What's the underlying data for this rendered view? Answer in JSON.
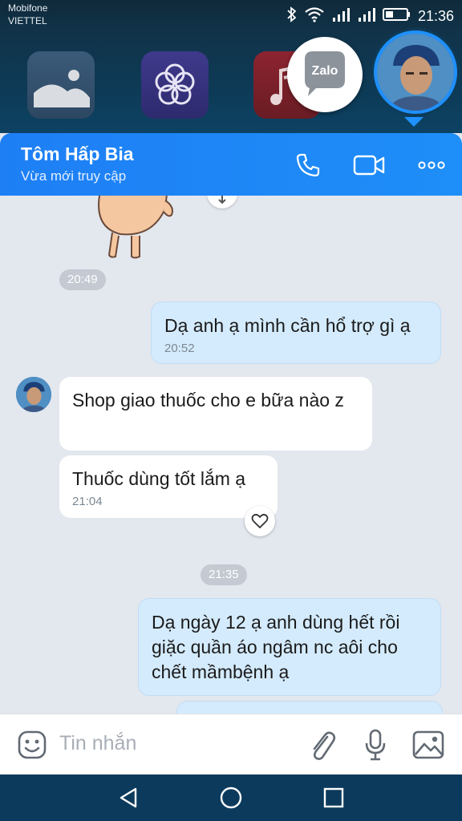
{
  "status_bar": {
    "carrier_1": "Mobifone",
    "carrier_2": "VIETTEL",
    "time": "21:36",
    "icons": [
      "bluetooth-icon",
      "wifi-icon",
      "signal-icon",
      "signal-icon",
      "battery-icon"
    ]
  },
  "launcher": {
    "apps": [
      "gallery-icon",
      "flower-app-icon",
      "music-icon"
    ],
    "zalo_bubble_label": "Zalo"
  },
  "header": {
    "contact_name": "Tôm Hấp Bia",
    "status": "Vừa mới truy cập",
    "actions": [
      "phone-icon",
      "video-call-icon",
      "more-icon"
    ]
  },
  "chat": {
    "time_separators": [
      "20:49",
      "21:35"
    ],
    "messages": [
      {
        "direction": "out",
        "text": "Dạ anh ạ mình cần hổ trợ gì ạ",
        "time": "20:52"
      },
      {
        "direction": "in",
        "text": "Shop giao thuốc cho e bữa nào z",
        "time": ""
      },
      {
        "direction": "in",
        "text": "Thuốc dùng tốt lắm ạ",
        "time": "21:04"
      },
      {
        "direction": "out",
        "text": "Dạ ngày 12 ạ anh dùng hết rồi giặc quần áo ngâm nc aôi cho chết mầmbệnh ạ",
        "time": ""
      }
    ]
  },
  "input": {
    "placeholder": "Tin nhắn",
    "icons": [
      "emoji-icon",
      "attachment-icon",
      "microphone-icon",
      "image-icon"
    ]
  },
  "colors": {
    "header_blue": "#1e88f7",
    "outgoing_bubble": "#d4ebfd",
    "incoming_bubble": "#ffffff",
    "chat_background": "#e3e7ee"
  }
}
